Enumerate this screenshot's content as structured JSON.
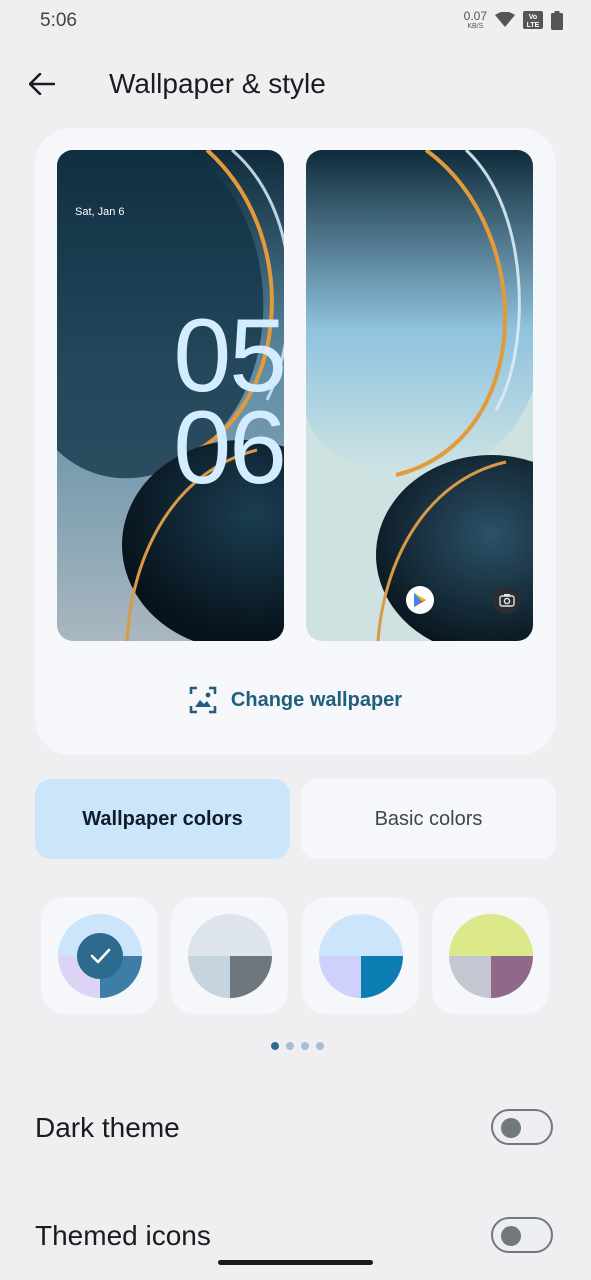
{
  "status_bar": {
    "time": "5:06",
    "net_speed": "0.07",
    "net_unit": "KB/S",
    "volte": "Vo LTE"
  },
  "app_bar": {
    "title": "Wallpaper & style"
  },
  "preview": {
    "lock_date": "Sat, Jan 6",
    "lock_hour": "05",
    "lock_minute": "06",
    "change_label": "Change wallpaper"
  },
  "tabs": [
    {
      "label": "Wallpaper colors",
      "selected": true
    },
    {
      "label": "Basic colors",
      "selected": false
    }
  ],
  "color_options": [
    {
      "top": "#cce5fb",
      "bottom_left": "#ddd3f5",
      "bottom_right": "#3d7da6",
      "selected": true
    },
    {
      "top": "#dde4ec",
      "bottom_left": "#c6d4e0",
      "bottom_right": "#6e767e",
      "selected": false
    },
    {
      "top": "#cce5fb",
      "bottom_left": "#cdd1fb",
      "bottom_right": "#0b7db3",
      "selected": false
    },
    {
      "top": "#dce88a",
      "bottom_left": "#c4c6d1",
      "bottom_right": "#8e6a88",
      "selected": false
    }
  ],
  "page_indicator": {
    "count": 4,
    "active": 0
  },
  "settings": {
    "dark_theme": {
      "label": "Dark theme",
      "on": false
    },
    "themed_icons": {
      "label": "Themed icons",
      "on": false
    }
  },
  "colors": {
    "accent": "#1f5f7c",
    "tab_selected": "#cbe6fb",
    "card": "#f6f7fb"
  }
}
